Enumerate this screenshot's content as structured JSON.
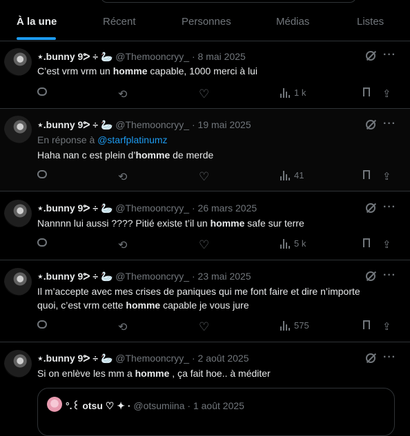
{
  "tabs": [
    "À la une",
    "Récent",
    "Personnes",
    "Médias",
    "Listes"
  ],
  "author": {
    "display_name": "⋆.bunny 9ᕗ ÷ 🦢",
    "handle": "@Themooncryy_"
  },
  "posts": [
    {
      "date": "8 mai 2025",
      "reply_to": "",
      "text_before": "C’est vrm vrm un ",
      "keyword": "homme",
      "text_after": " capable, 1000 merci à lui",
      "views": "1 k"
    },
    {
      "date": "19 mai 2025",
      "reply_label": "En réponse à",
      "reply_to": "@starfplatinumz",
      "text_before": "Haha nan c est plein d’",
      "keyword": "homme",
      "text_after": " de merde",
      "views": "41"
    },
    {
      "date": "26 mars 2025",
      "reply_to": "",
      "text_before": "Nannnn lui aussi ???? Pitié existe t’il un ",
      "keyword": "homme",
      "text_after": " safe sur terre",
      "views": "5 k"
    },
    {
      "date": "23 mai 2025",
      "reply_to": "",
      "text_before": "Il m’accepte avec mes crises de paniques qui me font faire et dire n’importe quoi, c’est vrm cette ",
      "keyword": "homme",
      "text_after": " capable je vous jure",
      "views": "575"
    },
    {
      "date": "2 août 2025",
      "reply_to": "",
      "text_before": "Si on enlève les mm a ",
      "keyword": "homme",
      "text_after": " , ça fait hoe.. à méditer",
      "views": ""
    }
  ],
  "quote": {
    "display_name": "°.꒰ otsu ♡ ✦ ·",
    "handle": "@otsumiina",
    "date": "1 août 2025"
  },
  "separator": "·",
  "colors": {
    "accent": "#1d9bf0",
    "muted": "#71767b",
    "text": "#e7e9ea",
    "border": "#2f3336"
  }
}
